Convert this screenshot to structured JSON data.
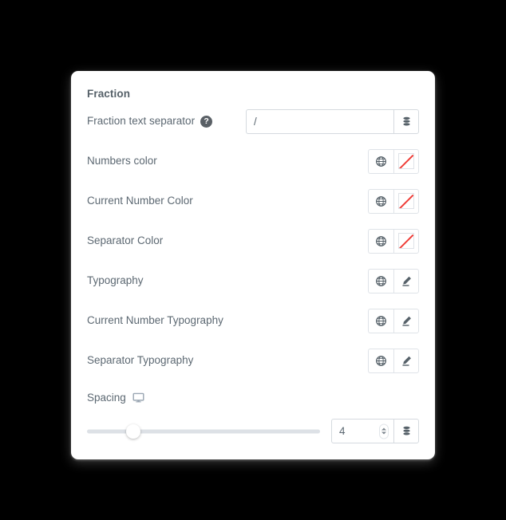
{
  "panel": {
    "title": "Fraction"
  },
  "separator_row": {
    "label": "Fraction text separator",
    "help_icon": "help-circle-icon",
    "value": "/",
    "placeholder": "",
    "addon_icon": "dynamic-tags-database-icon"
  },
  "color_rows": [
    {
      "label": "Numbers color",
      "global_icon": "globe-icon",
      "swatch_icon": "empty-color-swatch-icon",
      "swatch_value": "",
      "slash_color": "#ef3b36"
    },
    {
      "label": "Current Number Color",
      "global_icon": "globe-icon",
      "swatch_icon": "empty-color-swatch-icon",
      "swatch_value": "",
      "slash_color": "#ef3b36"
    },
    {
      "label": "Separator Color",
      "global_icon": "globe-icon",
      "swatch_icon": "empty-color-swatch-icon",
      "swatch_value": "",
      "slash_color": "#ef3b36"
    }
  ],
  "typography_rows": [
    {
      "label": "Typography",
      "global_icon": "globe-icon",
      "edit_icon": "pencil-edit-icon"
    },
    {
      "label": "Current Number Typography",
      "global_icon": "globe-icon",
      "edit_icon": "pencil-edit-icon"
    },
    {
      "label": "Separator Typography",
      "global_icon": "globe-icon",
      "edit_icon": "pencil-edit-icon"
    }
  ],
  "spacing": {
    "label": "Spacing",
    "device_icon": "desktop-monitor-icon",
    "value": "4",
    "slider_percent": 20,
    "spinner_up_icon": "chevron-up-icon",
    "spinner_down_icon": "chevron-down-icon",
    "addon_icon": "dynamic-tags-database-icon"
  },
  "colors": {
    "page_background": "#000000",
    "panel_background": "#ffffff",
    "label_text": "#5c6872",
    "title_text": "#556068",
    "border": "#d5dadf",
    "icon": "#566169",
    "slider_track": "#dde1e6",
    "accent_red": "#ef3b36"
  }
}
